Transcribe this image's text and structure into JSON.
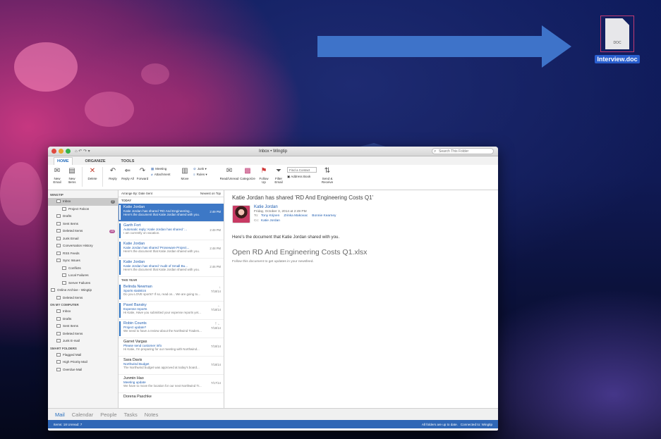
{
  "desktop": {
    "file": {
      "name": "Interview.doc",
      "type_label": "DOC"
    }
  },
  "window": {
    "title": "Inbox • Wingtip",
    "search_placeholder": "Search This Folder",
    "tabs": [
      "HOME",
      "ORGANIZE",
      "TOOLS"
    ],
    "ribbon": {
      "new_email": "New Email",
      "new_items": "New Items",
      "delete": "Delete",
      "reply": "Reply",
      "reply_all": "Reply All",
      "forward": "Forward",
      "meeting": "Meeting",
      "attachment": "Attachment",
      "move": "Move",
      "junk": "Junk",
      "rules": "Rules",
      "read_unread": "Read/Unread",
      "categorize": "Categorize",
      "follow_up": "Follow Up",
      "filter_email": "Filter Email",
      "find_contact": "Find a Contact",
      "address_book": "Address Book",
      "send_receive": "Send & Receive"
    }
  },
  "folders": {
    "account": "WINGTIP",
    "items": [
      {
        "label": "Inbox",
        "badge": "7",
        "selected": true,
        "indent": 1
      },
      {
        "label": "Project Falcon",
        "indent": 2
      },
      {
        "label": "Drafts",
        "indent": 1
      },
      {
        "label": "Sent Items",
        "indent": 1
      },
      {
        "label": "Deleted Items",
        "badge": "15",
        "indent": 1
      },
      {
        "label": "Junk Email",
        "indent": 1
      },
      {
        "label": "Conversation History",
        "indent": 1
      },
      {
        "label": "RSS Feeds",
        "indent": 1
      },
      {
        "label": "Sync Issues",
        "indent": 1
      },
      {
        "label": "Conflicts",
        "indent": 2
      },
      {
        "label": "Local Failures",
        "indent": 2
      },
      {
        "label": "Server Failures",
        "indent": 2
      }
    ],
    "archive_label": "Online Archive - Wingtip",
    "archive_items": [
      {
        "label": "Deleted Items",
        "indent": 1
      }
    ],
    "on_my_computer": "ON MY COMPUTER",
    "computer_items": [
      {
        "label": "Inbox",
        "indent": 1
      },
      {
        "label": "Drafts",
        "indent": 1
      },
      {
        "label": "Sent Items",
        "indent": 1
      },
      {
        "label": "Deleted Items",
        "indent": 1
      },
      {
        "label": "Junk E-mail",
        "indent": 1
      }
    ],
    "smart_folders": "SMART FOLDERS",
    "smart_items": [
      {
        "label": "Flagged Mail",
        "indent": 1
      },
      {
        "label": "High Priority Mail",
        "indent": 1
      },
      {
        "label": "Overdue Mail",
        "indent": 1
      }
    ]
  },
  "message_list": {
    "arrange_by": "Arrange By: Date Sent",
    "sort_order": "Newest on Top",
    "group_today": "TODAY",
    "group_this_year": "THIS YEAR",
    "today": [
      {
        "from": "Katie Jordan",
        "subject": "Katie Jordan has shared 'RD And Engineering...",
        "preview": "Here's the document that Katie Jordan shared with you.",
        "time": "2:49 PM",
        "selected": true,
        "unread": true
      },
      {
        "from": "Garth Fort",
        "subject": "Automatic reply: Katie Jordan has shared '...",
        "preview": "I am currently on vacation.",
        "time": "2:49 PM",
        "unread": true
      },
      {
        "from": "Katie Jordan",
        "subject": "Katie Jordan has shared 'Proseware Project...",
        "preview": "Here's the document that Katie Jordan shared with you.",
        "time": "2:48 PM",
        "unread": true
      },
      {
        "from": "Katie Jordan",
        "subject": "Katie Jordan has shared 'Audit of Small Bu...",
        "preview": "Here's the document that Katie Jordan shared with you.",
        "time": "2:46 PM",
        "unread": true
      }
    ],
    "this_year": [
      {
        "from": "Belinda Newman",
        "subject": "Sports statistics",
        "preview": "Do you LOVE sports? If so, read on... We are going to...",
        "time": "7/18/14",
        "unread": true,
        "icon": "↓"
      },
      {
        "from": "Pavel Bansky",
        "subject": "Expense reports",
        "preview": "Hi Katie, Have you submitted your expense reports yet...",
        "time": "7/18/14",
        "unread": true,
        "icon": "←"
      },
      {
        "from": "Robin Counts",
        "subject": "Project update?",
        "preview": "We need to have a review about the Northwind Traders...",
        "time": "7/18/14",
        "unread": true,
        "icon": "! ←"
      },
      {
        "from": "Garret Vargas",
        "subject": "Please send customer info",
        "preview": "Hi Katie, I'm preparing for our meeting with Northwind...",
        "time": "7/18/14"
      },
      {
        "from": "Sara Davis",
        "subject": "Northwind Budget",
        "preview": "The Northwind budget was approved at today's board...",
        "time": "7/18/14"
      },
      {
        "from": "Junmin Hao",
        "subject": "Meeting update",
        "preview": "We have to move the location for our next Northwind Tr...",
        "time": "7/17/14"
      },
      {
        "from": "Dorena Paschke",
        "subject": "",
        "preview": "",
        "time": ""
      }
    ]
  },
  "reading_pane": {
    "subject": "Katie Jordan has shared 'RD And Engineering Costs Q1'",
    "sender": "Katie Jordan",
    "date": "Friday, October 3, 2014 at 2:49 PM",
    "to_label": "To:",
    "to": [
      "Tony Krijnen",
      "Zrinka Makovac",
      "Bonnie Kearney"
    ],
    "cc_label": "Cc:",
    "cc": "Katie Jordan",
    "body": "Here's the document that Katie Jordan shared with you.",
    "link": "Open RD And Engineering Costs Q1.xlsx",
    "follow": "Follow this document to get updates in your newsfeed."
  },
  "nav": [
    "Mail",
    "Calendar",
    "People",
    "Tasks",
    "Notes"
  ],
  "status": {
    "left": "Items: 18    Unread: 7",
    "right_sync": "All folders are up to date.",
    "right_conn": "Connected to: Wingtip"
  },
  "colors": {
    "accent": "#2a6fbd",
    "selection": "#3d78c6",
    "status_bar": "#2f67b6",
    "arrow": "#3e73c9"
  }
}
